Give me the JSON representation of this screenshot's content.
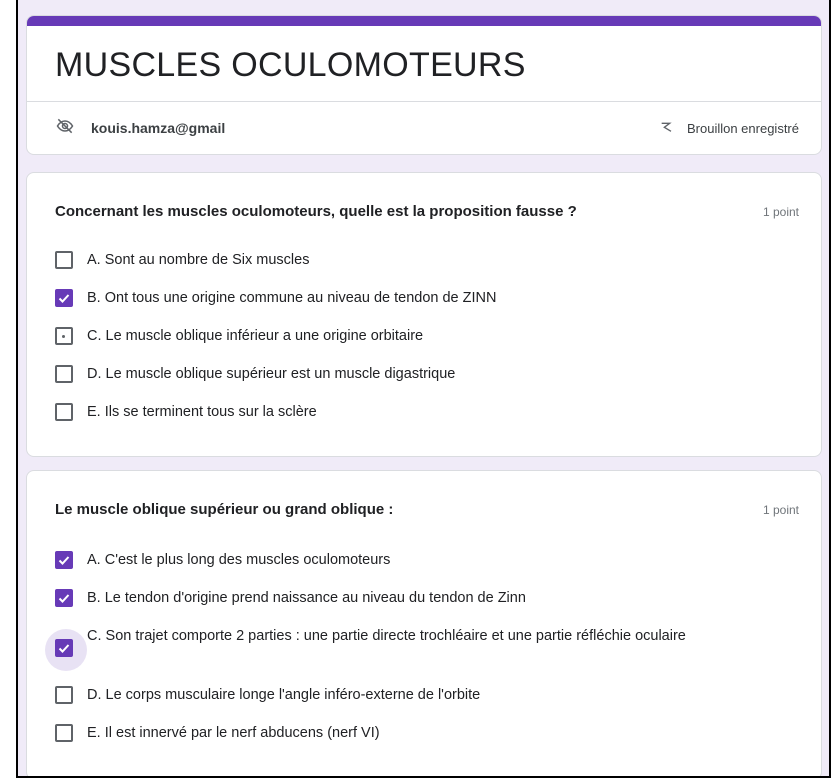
{
  "form": {
    "title": "MUSCLES OCULOMOTEURS",
    "account_email": "kouis.hamza@gmail",
    "draft_status": "Brouillon enregistré",
    "accent_color": "#673ab7"
  },
  "questions": [
    {
      "title": "Concernant les muscles oculomoteurs, quelle est la proposition fausse ?",
      "points": "1 point",
      "options": [
        {
          "label": "A. Sont au nombre de Six muscles",
          "checked": false
        },
        {
          "label": "B. Ont tous une origine commune au niveau de tendon de ZINN",
          "checked": true
        },
        {
          "label": "C. Le muscle oblique inférieur a une origine orbitaire",
          "checked": false
        },
        {
          "label": "D. Le muscle oblique supérieur est un muscle digastrique",
          "checked": false
        },
        {
          "label": "E. Ils se terminent tous sur la sclère",
          "checked": false
        }
      ]
    },
    {
      "title": "Le muscle oblique supérieur ou grand oblique :",
      "points": "1 point",
      "options": [
        {
          "label": "A. C'est le plus long des muscles oculomoteurs",
          "checked": true
        },
        {
          "label": "B. Le tendon d'origine prend naissance au niveau du tendon de Zinn",
          "checked": true
        },
        {
          "label": "C. Son trajet comporte 2 parties : une partie directe trochléaire et une partie réfléchie oculaire",
          "checked": true
        },
        {
          "label": "D. Le corps musculaire longe l'angle inféro-externe de l'orbite",
          "checked": false
        },
        {
          "label": "E. Il est innervé par le nerf abducens (nerf VI)",
          "checked": false
        }
      ]
    }
  ]
}
